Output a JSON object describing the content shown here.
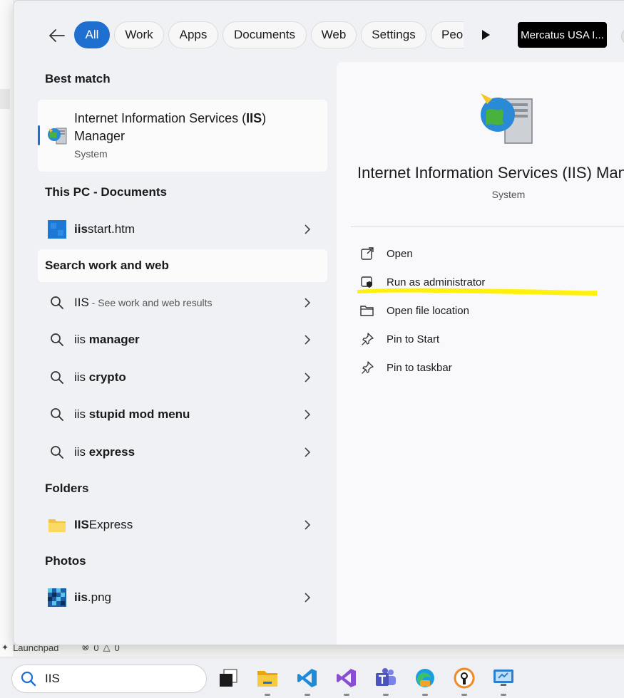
{
  "filters": {
    "tabs": [
      {
        "label": "All",
        "active": true
      },
      {
        "label": "Work"
      },
      {
        "label": "Apps"
      },
      {
        "label": "Documents"
      },
      {
        "label": "Web"
      },
      {
        "label": "Settings"
      },
      {
        "label": "Peop"
      }
    ],
    "account_label": "Mercatus USA I..."
  },
  "results": {
    "best_match_header": "Best match",
    "best_match": {
      "title_before": "Internet Information Services (",
      "title_bold": "IIS",
      "title_after": ")",
      "title_line2": "Manager",
      "subtitle": "System",
      "icon": "iis-manager-icon"
    },
    "this_pc_header": "This PC - Documents",
    "documents": [
      {
        "bold": "iis",
        "rest": "start.htm",
        "icon": "html-file-icon"
      }
    ],
    "search_web_header": "Search work and web",
    "searches": [
      {
        "plain": "IIS",
        "bold": "",
        "hint": " - See work and web results"
      },
      {
        "plain": "iis ",
        "bold": "manager",
        "hint": ""
      },
      {
        "plain": "iis ",
        "bold": "crypto",
        "hint": ""
      },
      {
        "plain": "iis ",
        "bold": "stupid mod menu",
        "hint": ""
      },
      {
        "plain": "iis ",
        "bold": "express",
        "hint": ""
      }
    ],
    "folders_header": "Folders",
    "folders": [
      {
        "bold": "IIS",
        "rest": "Express",
        "icon": "folder-icon"
      }
    ],
    "photos_header": "Photos",
    "photos": [
      {
        "bold": "iis",
        "rest": ".png",
        "icon": "image-file-icon"
      }
    ]
  },
  "detail": {
    "title": "Internet Information Services (IIS) Man",
    "type": "System",
    "actions": [
      {
        "label": "Open",
        "icon": "open-external-icon"
      },
      {
        "label": "Run as administrator",
        "icon": "shield-admin-icon"
      },
      {
        "label": "Open file location",
        "icon": "folder-open-icon"
      },
      {
        "label": "Pin to Start",
        "icon": "pin-icon"
      },
      {
        "label": "Pin to taskbar",
        "icon": "pin-icon"
      }
    ],
    "highlight_color": "#ffef00"
  },
  "background": {
    "status_label": "Launchpad",
    "errors": "0",
    "warnings": "0"
  },
  "taskbar": {
    "search_text": "IIS",
    "apps": [
      "task-view-icon",
      "file-explorer-icon",
      "vscode-icon",
      "visual-studio-icon",
      "teams-icon",
      "edge-icon",
      "vpn-icon",
      "remote-desktop-icon"
    ]
  },
  "colors": {
    "accent": "#1f6fd0",
    "panel_bg": "#f0f1f4"
  }
}
